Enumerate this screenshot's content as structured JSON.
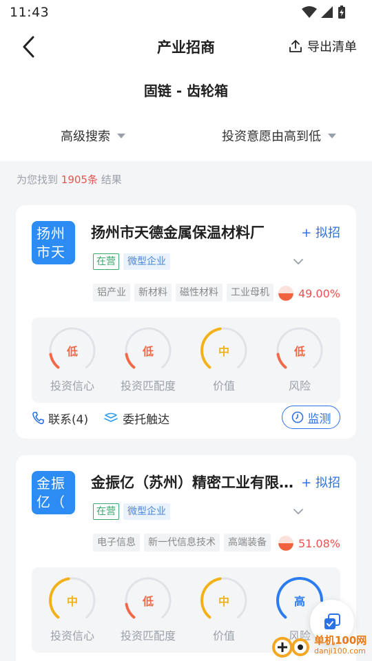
{
  "status_bar": {
    "time": "11:43"
  },
  "header": {
    "title": "产业招商",
    "export_label": "导出清单"
  },
  "subtitle": "固链 - 齿轮箱",
  "filters": {
    "search_label": "高级搜索",
    "sort_label": "投资意愿由高到低"
  },
  "result": {
    "prefix": "为您找到",
    "count": "1905条",
    "suffix": "结果"
  },
  "colors": {
    "accent": "#2b72e6",
    "low": "#f06a4a",
    "mid": "#f2b118",
    "high": "#2b7cf0",
    "logo_bg": "#2c8cf4"
  },
  "cards": [
    {
      "logo_text": [
        "扬州",
        "市天"
      ],
      "name": "扬州市天德金属保温材料厂",
      "plan_label": "+ 拟招",
      "status_tag": "在营",
      "size_tag": "微型企业",
      "industries": [
        "铝产业",
        "新材料",
        "磁性材料",
        "工业母机"
      ],
      "percent": "49.00%",
      "percent_fill": 0.49,
      "metrics": [
        {
          "level": "低",
          "label": "投资信心",
          "color": "low"
        },
        {
          "level": "低",
          "label": "投资匹配度",
          "color": "low"
        },
        {
          "level": "中",
          "label": "价值",
          "color": "mid"
        },
        {
          "level": "低",
          "label": "风险",
          "color": "low"
        }
      ],
      "contact_label": "联系(4)",
      "delegate_label": "委托触达",
      "monitor_label": "监测"
    },
    {
      "logo_text": [
        "金振",
        "亿（"
      ],
      "name": "金振亿（苏州）精密工业有限公司",
      "plan_label": "+ 拟招",
      "status_tag": "在营",
      "size_tag": "微型企业",
      "industries": [
        "电子信息",
        "新一代信息技术",
        "高端装备"
      ],
      "percent": "51.08%",
      "percent_fill": 0.51,
      "metrics": [
        {
          "level": "中",
          "label": "投资信心",
          "color": "mid"
        },
        {
          "level": "低",
          "label": "投资匹配度",
          "color": "low"
        },
        {
          "level": "中",
          "label": "价值",
          "color": "mid"
        },
        {
          "level": "高",
          "label": "风险",
          "color": "high"
        }
      ]
    }
  ],
  "watermark": {
    "line1": "单机100网",
    "line2": "danji100.com"
  }
}
